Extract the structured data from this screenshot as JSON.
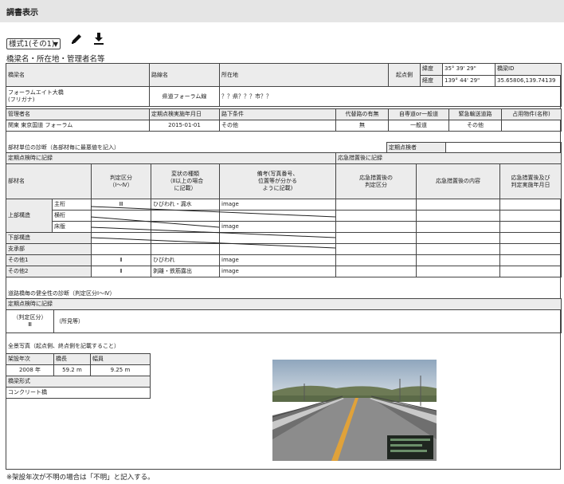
{
  "page": {
    "title": "調書表示"
  },
  "form": {
    "selected": "様式1(その1)",
    "subtitle": "橋梁名・所在地・管理者名等"
  },
  "header": {
    "bridge_name_label": "橋梁名",
    "route_label": "路線名",
    "location_label": "所在地",
    "origin_label": "起点側",
    "lat_label": "緯度",
    "lat_value": "35° 39' 29\"",
    "lon_label": "経度",
    "lon_value": "139° 44' 29\"",
    "bridge_id_label": "橋梁ID",
    "bridge_id_value": "35.65806,139.74139",
    "bridge_name": "フォーラムエイト大橋",
    "furigana": "(フリガナ)",
    "route": "県道フォーラム線",
    "location": "？？県？？？市？？",
    "admin_label": "管理者名",
    "inspect_date_label": "定期点検実施年月日",
    "under_label": "路下条件",
    "detour_label": "代替路の有無",
    "road_label": "自専道or一般道",
    "emergency_label": "緊急輸送道路",
    "occupancy_label": "占用物件(名称)",
    "admin": "関東 東京国道 フォーラム",
    "inspect_date": "2015-01-01",
    "under": "その他",
    "detour": "無",
    "road": "一般道",
    "emergency": "その他"
  },
  "diagnosis": {
    "section_title": "部材単位の診断（各部材毎に最悪値を記入）",
    "inspector_label": "定期点検者",
    "periodic_label": "定期点検時に記録",
    "emergency_label": "応急措置後に記録",
    "col_member": "部材名",
    "col_judge": [
      "判定区分",
      "（Ⅰ〜Ⅳ）"
    ],
    "col_damage": [
      "変状の種類",
      "（Ⅱ以上の場合",
      "に記載）"
    ],
    "col_remarks": [
      "備考(写真番号、",
      "位置等が分かる",
      "ように記載)"
    ],
    "col_after": [
      "応急措置後の",
      "判定区分"
    ],
    "col_content": "応急措置後の内容",
    "col_date": [
      "応急措置後及び",
      "判定実施年月日"
    ],
    "super": "上部構造",
    "rows": [
      {
        "sub": "主桁",
        "judge": "Ⅲ",
        "damage": "ひびわれ・漏水",
        "remarks": "image"
      },
      {
        "sub": "横桁",
        "judge": "",
        "damage": "",
        "remarks": ""
      },
      {
        "sub": "床版",
        "judge": "",
        "damage": "",
        "remarks": "image"
      },
      {
        "member": "下部構造",
        "judge": "",
        "damage": "",
        "remarks": ""
      },
      {
        "member": "支承部",
        "judge": "",
        "damage": "",
        "remarks": ""
      },
      {
        "member": "その他1",
        "judge": "Ⅱ",
        "damage": "ひびわれ",
        "remarks": "image"
      },
      {
        "member": "その他2",
        "judge": "Ⅱ",
        "damage": "剥離・鉄筋露出",
        "remarks": "image"
      }
    ]
  },
  "health": {
    "title": "道路橋毎の健全性の診断（判定区分Ⅰ〜Ⅳ）",
    "periodic_label": "定期点検時に記録",
    "judge_label": "（判定区分）",
    "judge_value": "Ⅲ",
    "findings_label": "（所見等）"
  },
  "photo": {
    "title": "全景写真（起点側、終点側を記載すること）",
    "year_label": "架設年次",
    "length_label": "橋長",
    "width_label": "幅員",
    "year": "2008 年",
    "length": "59.2 m",
    "width": "9.25 m",
    "type_label": "橋梁形式",
    "type": "コンクリート橋"
  },
  "footer": {
    "note": "※架設年次が不明の場合は「不明」と記入する。"
  },
  "colors": {
    "header_bg": "#e5e5e5",
    "cell_header_bg": "#ececec",
    "border": "#444444"
  }
}
